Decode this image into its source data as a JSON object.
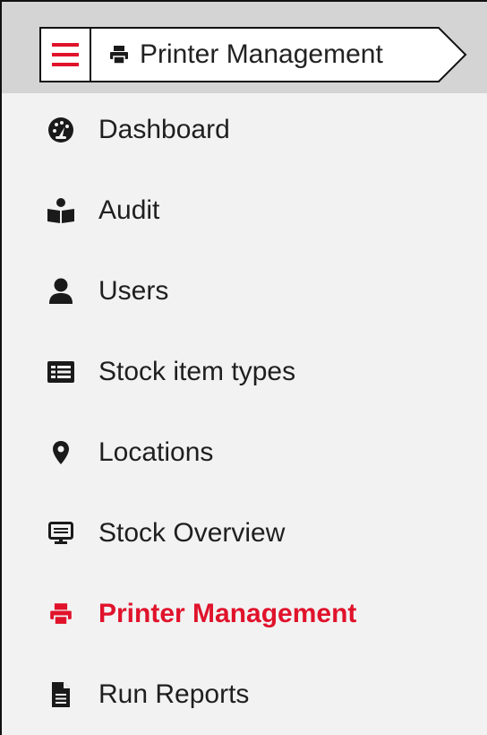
{
  "colors": {
    "accent": "#e0132b",
    "text": "#1f1f1f",
    "header_bg": "#d4d4d4",
    "sidebar_bg": "#f2f2f2"
  },
  "header": {
    "menu_icon": "hamburger-menu-icon",
    "breadcrumb": {
      "icon": "printer-icon",
      "label": "Printer Management"
    }
  },
  "sidebar": {
    "items": [
      {
        "label": "Dashboard",
        "icon": "tachometer-icon",
        "active": false
      },
      {
        "label": "Audit",
        "icon": "reader-book-icon",
        "active": false
      },
      {
        "label": "Users",
        "icon": "user-icon",
        "active": false
      },
      {
        "label": "Stock item types",
        "icon": "list-table-icon",
        "active": false
      },
      {
        "label": "Locations",
        "icon": "map-marker-icon",
        "active": false
      },
      {
        "label": "Stock Overview",
        "icon": "monitor-icon",
        "active": false
      },
      {
        "label": "Printer Management",
        "icon": "printer-icon",
        "active": true
      },
      {
        "label": "Run Reports",
        "icon": "document-icon",
        "active": false
      }
    ]
  }
}
